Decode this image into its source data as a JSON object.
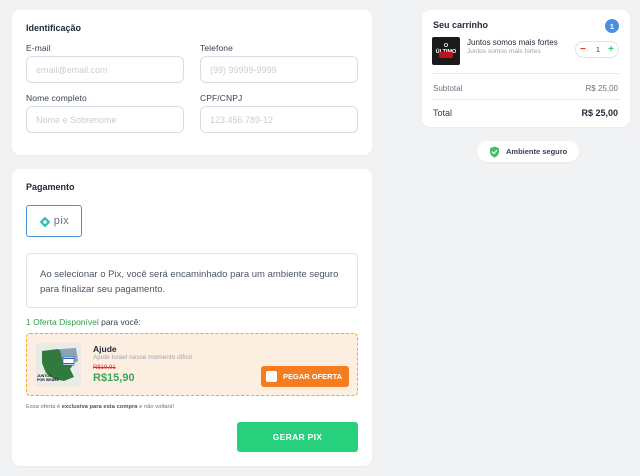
{
  "identification": {
    "title": "Identificação",
    "email": {
      "label": "E-mail",
      "placeholder": "email@email.com",
      "value": ""
    },
    "phone": {
      "label": "Telefone",
      "placeholder": "(99) 99999-9999",
      "value": ""
    },
    "name": {
      "label": "Nome completo",
      "placeholder": "Nome e Sobrenome",
      "value": ""
    },
    "doc": {
      "label": "CPF/CNPJ",
      "placeholder": "123.456.789-12",
      "value": ""
    }
  },
  "cart": {
    "title": "Seu carrinho",
    "count": "1",
    "item": {
      "name": "Juntos somos mais fortes",
      "description": "Juntos somos mais fortes",
      "thumb_text": "O ÚLTIMO",
      "quantity": "1",
      "minus": "−",
      "plus": "+"
    },
    "subtotal_label": "Subtotal",
    "subtotal_value": "R$ 25,00",
    "total_label": "Total",
    "total_value": "R$ 25,00"
  },
  "secure": {
    "label": "Ambiente seguro",
    "icon": "shield-check-icon",
    "color": "#3fbf6a"
  },
  "payment": {
    "title": "Pagamento",
    "method_label": "pix",
    "info": "Ao selecionar o Pix, você será encaminhado para um ambiente seguro para finalizar seu pagamento.",
    "offer_count": "1 Oferta Disponível",
    "offer_suffix": " para você:",
    "offer": {
      "image_caption": "JUNTOS POR ISRAEL",
      "title": "Ajude",
      "subtitle": "Ajude Israel nesse momento difícil",
      "old_price": "R$19,91",
      "new_price": "R$15,90",
      "button": "PEGAR OFERTA"
    },
    "fine_prefix": "Essa oferta é ",
    "fine_bold": "exclusiva para esta compra",
    "fine_suffix": " e não voltará!",
    "submit": "GERAR PIX",
    "accent": "#26d07c"
  }
}
